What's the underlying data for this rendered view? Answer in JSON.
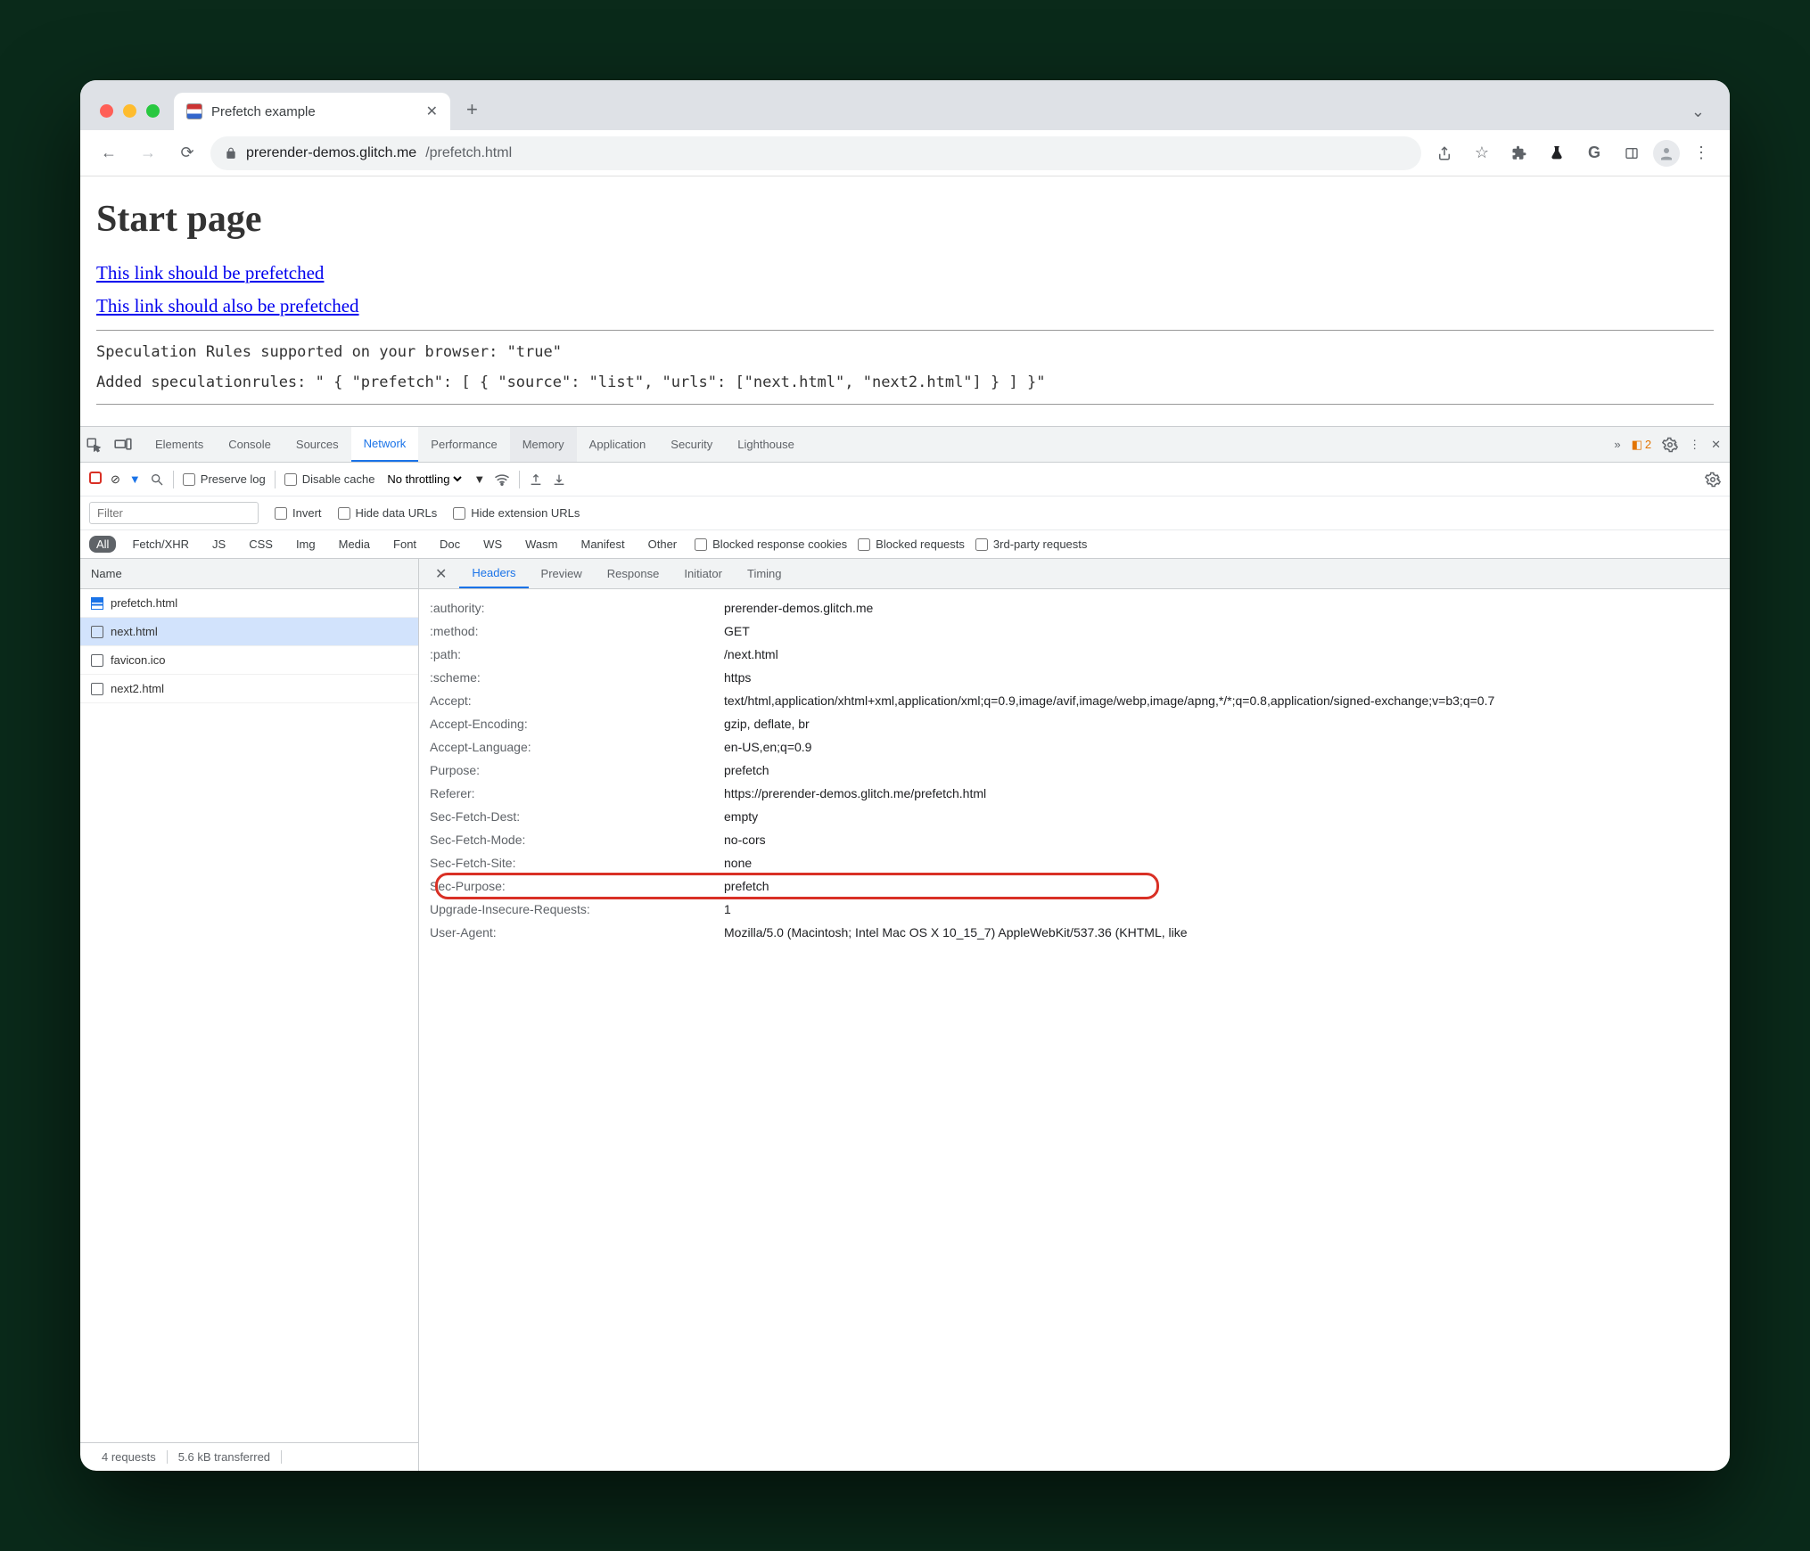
{
  "tab": {
    "title": "Prefetch example"
  },
  "url": {
    "host": "prerender-demos.glitch.me",
    "path": "/prefetch.html"
  },
  "page": {
    "heading": "Start page",
    "link1": "This link should be prefetched",
    "link2": "This link should also be prefetched",
    "line1": "Speculation Rules supported on your browser: \"true\"",
    "line2": "Added speculationrules: \" { \"prefetch\": [ { \"source\": \"list\", \"urls\": [\"next.html\", \"next2.html\"] } ] }\""
  },
  "devtools": {
    "panels": [
      "Elements",
      "Console",
      "Sources",
      "Network",
      "Performance",
      "Memory",
      "Application",
      "Security",
      "Lighthouse"
    ],
    "activePanel": "Network",
    "warnCount": "2",
    "sub": {
      "preserve": "Preserve log",
      "disable": "Disable cache",
      "throttle": "No throttling"
    },
    "filter": {
      "placeholder": "Filter",
      "invert": "Invert",
      "hideData": "Hide data URLs",
      "hideExt": "Hide extension URLs"
    },
    "types": [
      "All",
      "Fetch/XHR",
      "JS",
      "CSS",
      "Img",
      "Media",
      "Font",
      "Doc",
      "WS",
      "Wasm",
      "Manifest",
      "Other"
    ],
    "blocks": {
      "cookies": "Blocked response cookies",
      "req": "Blocked requests",
      "third": "3rd-party requests"
    },
    "listHeader": "Name",
    "requests": [
      {
        "name": "prefetch.html",
        "type": "doc"
      },
      {
        "name": "next.html",
        "type": "file",
        "selected": true
      },
      {
        "name": "favicon.ico",
        "type": "file"
      },
      {
        "name": "next2.html",
        "type": "file"
      }
    ],
    "hdrTabs": [
      "Headers",
      "Preview",
      "Response",
      "Initiator",
      "Timing"
    ],
    "headers": [
      {
        "k": ":authority:",
        "v": "prerender-demos.glitch.me"
      },
      {
        "k": ":method:",
        "v": "GET"
      },
      {
        "k": ":path:",
        "v": "/next.html"
      },
      {
        "k": ":scheme:",
        "v": "https"
      },
      {
        "k": "Accept:",
        "v": "text/html,application/xhtml+xml,application/xml;q=0.9,image/avif,image/webp,image/apng,*/*;q=0.8,application/signed-exchange;v=b3;q=0.7"
      },
      {
        "k": "Accept-Encoding:",
        "v": "gzip, deflate, br"
      },
      {
        "k": "Accept-Language:",
        "v": "en-US,en;q=0.9"
      },
      {
        "k": "Purpose:",
        "v": "prefetch"
      },
      {
        "k": "Referer:",
        "v": "https://prerender-demos.glitch.me/prefetch.html"
      },
      {
        "k": "Sec-Fetch-Dest:",
        "v": "empty"
      },
      {
        "k": "Sec-Fetch-Mode:",
        "v": "no-cors"
      },
      {
        "k": "Sec-Fetch-Site:",
        "v": "none"
      },
      {
        "k": "Sec-Purpose:",
        "v": "prefetch",
        "hl": true
      },
      {
        "k": "Upgrade-Insecure-Requests:",
        "v": "1"
      },
      {
        "k": "User-Agent:",
        "v": "Mozilla/5.0 (Macintosh; Intel Mac OS X 10_15_7) AppleWebKit/537.36 (KHTML, like"
      }
    ],
    "status": {
      "reqs": "4 requests",
      "xfer": "5.6 kB transferred"
    }
  }
}
